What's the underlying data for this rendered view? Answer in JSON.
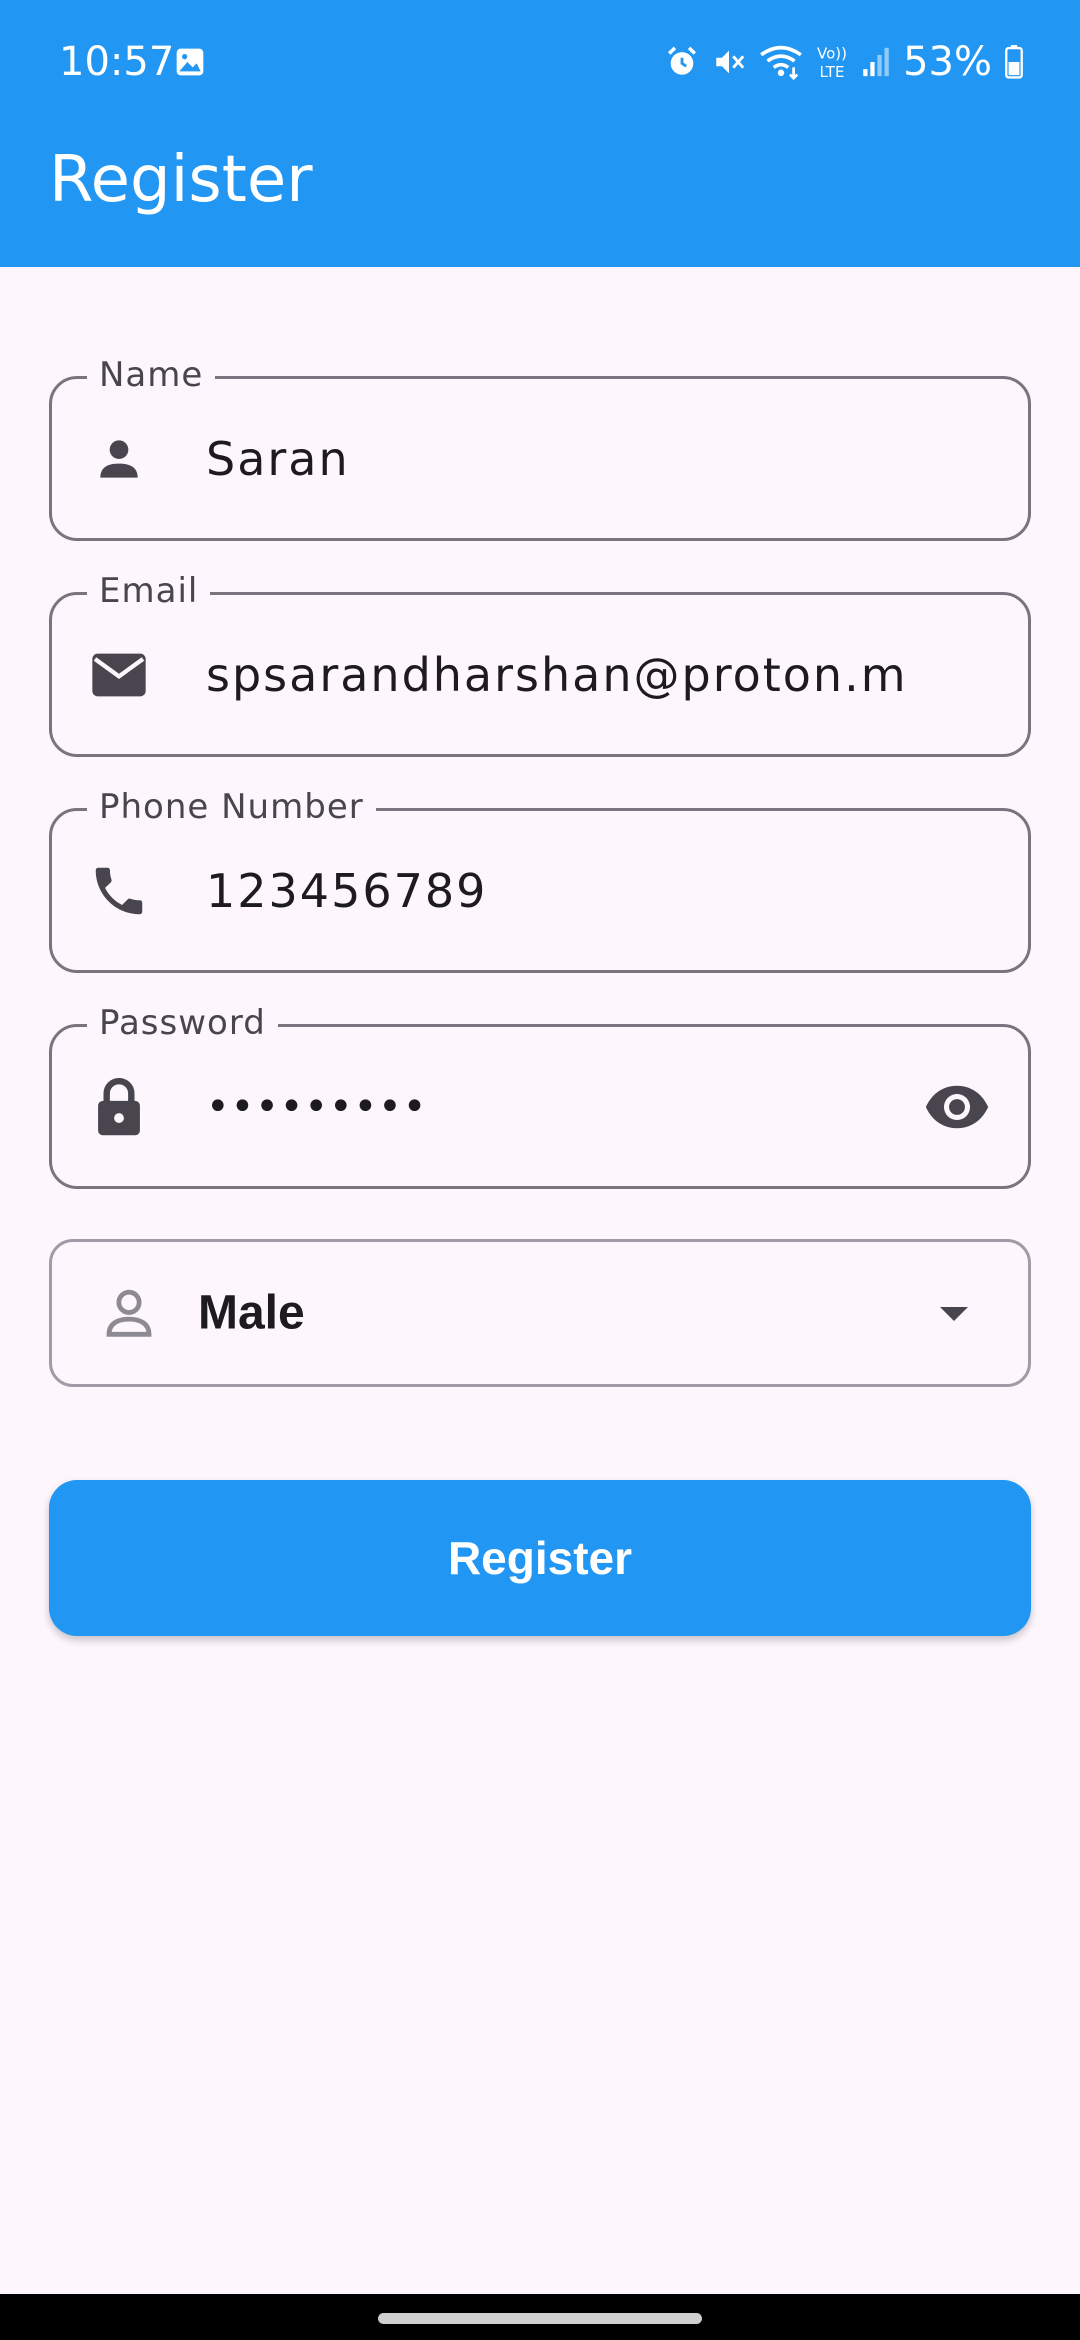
{
  "status_bar": {
    "time": "10:57",
    "battery_percent": "53%",
    "icons": [
      "gallery-icon",
      "alarm-icon",
      "mute-icon",
      "wifi-icon",
      "volte-icon",
      "signal-icon",
      "battery-icon"
    ]
  },
  "app_bar": {
    "title": "Register",
    "color": "#2196f3"
  },
  "form": {
    "name": {
      "label": "Name",
      "value": "Saran",
      "icon": "person-icon"
    },
    "email": {
      "label": "Email",
      "value": "spsarandharshan@proton.me",
      "icon": "mail-icon"
    },
    "phone": {
      "label": "Phone Number",
      "value": "123456789",
      "icon": "phone-icon"
    },
    "password": {
      "label": "Password",
      "value": "•••••••••",
      "icon": "lock-icon",
      "trailing_icon": "eye-icon"
    },
    "gender": {
      "value": "Male",
      "icon": "person-outline-icon",
      "trailing_icon": "arrow-drop-down-icon"
    }
  },
  "register_button": {
    "label": "Register"
  }
}
